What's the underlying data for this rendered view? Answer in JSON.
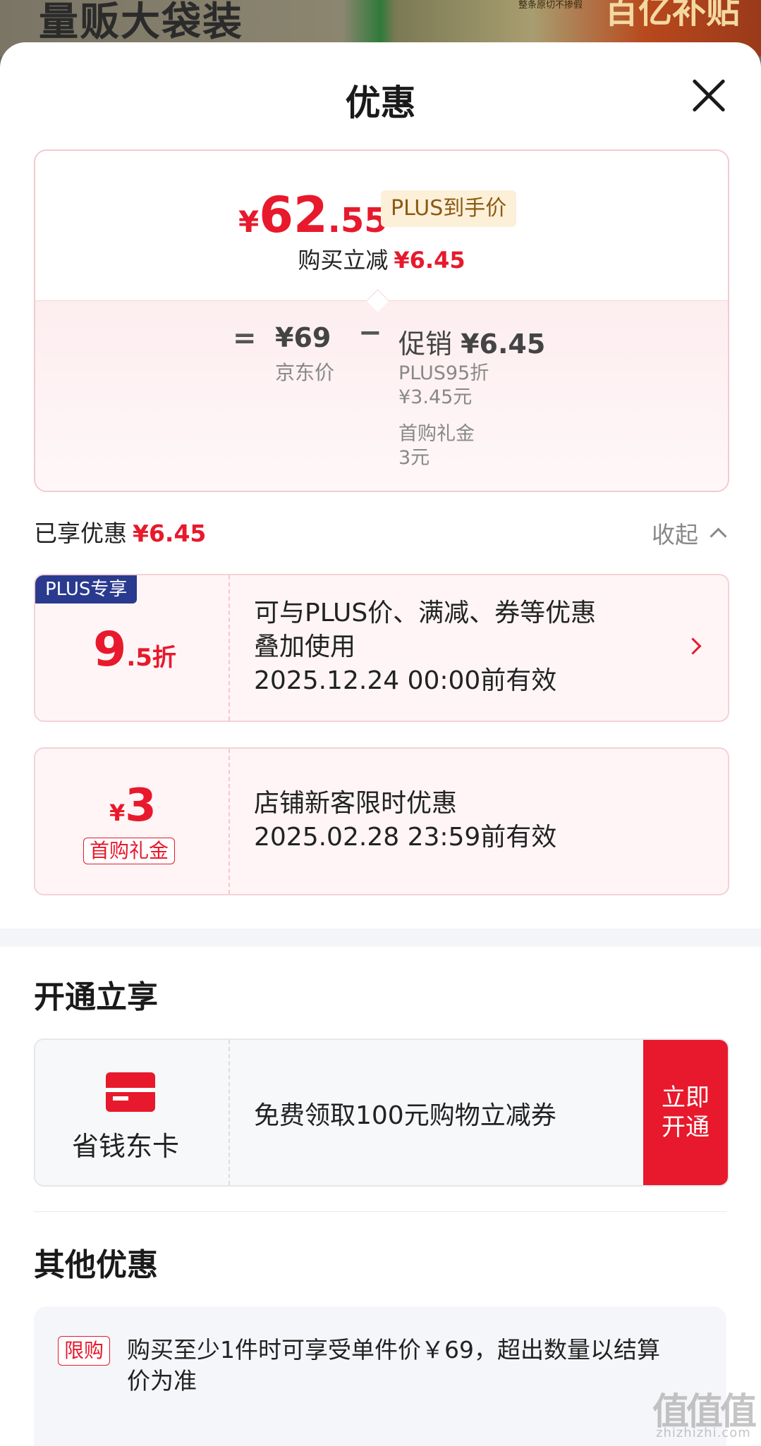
{
  "background": {
    "left_text": "量贩大袋装",
    "mid_text": "整条原切不掺假",
    "right_text": "百亿补贴"
  },
  "header": {
    "title": "优惠"
  },
  "price_summary": {
    "currency": "¥",
    "price_int": "62",
    "price_dec": ".55",
    "badge": "PLUS到手价",
    "reduce_label": "购买立减",
    "reduce_amount": "¥6.45",
    "equals": "=",
    "jd_price": "¥69",
    "jd_label": "京东价",
    "minus": "−",
    "promo_label": "促销",
    "promo_amount": "¥6.45",
    "promo_items": [
      "PLUS95折",
      "¥3.45元",
      "首购礼金",
      "3元"
    ]
  },
  "enjoyed": {
    "label": "已享优惠",
    "amount": "¥6.45",
    "collapse_label": "收起"
  },
  "coupons": [
    {
      "tag": "PLUS专享",
      "discount_big": "9",
      "discount_small": ".5折",
      "line1": "可与PLUS价、满减、券等优惠",
      "line2": "叠加使用",
      "validity": "2025.12.24 00:00前有效"
    },
    {
      "currency": "¥",
      "amount": "3",
      "tag": "首购礼金",
      "line1": "店铺新客限时优惠",
      "validity": "2025.02.28 23:59前有效"
    }
  ],
  "open_section": {
    "title": "开通立享",
    "card_name": "省钱东卡",
    "description": "免费领取100元购物立减券",
    "button_label": "立即开通"
  },
  "other_section": {
    "title": "其他优惠",
    "limit_tag": "限购",
    "limit_text": "购买至少1件时可享受单件价￥69，超出数量以结算价为准"
  },
  "watermark": {
    "logo": "值值值",
    "url": "zhizhizhi.com"
  },
  "colors": {
    "accent_red": "#e8192c",
    "plus_blue": "#2a3a8f",
    "badge_gold": "#8a5a12"
  }
}
